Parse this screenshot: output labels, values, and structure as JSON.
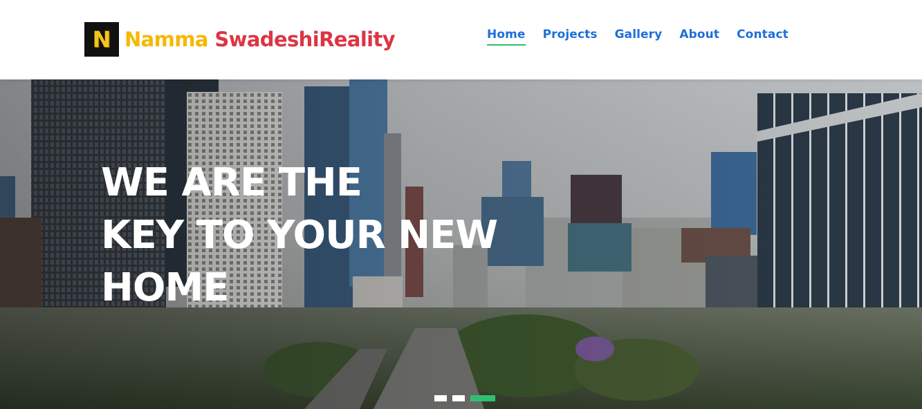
{
  "brand": {
    "logo_letter": "N",
    "name_part1": "Namma ",
    "name_part2": "SwadeshiReality",
    "colors": {
      "part1": "#f5b800",
      "part2": "#dc3545",
      "logo_bg": "#111111",
      "logo_letter": "#f5c518"
    }
  },
  "nav": {
    "items": [
      {
        "label": "Home",
        "active": true
      },
      {
        "label": "Projects",
        "active": false
      },
      {
        "label": "Gallery",
        "active": false
      },
      {
        "label": "About",
        "active": false
      },
      {
        "label": "Contact",
        "active": false
      }
    ],
    "colors": {
      "link": "#1e6fd9",
      "active_underline": "#2fbf71"
    }
  },
  "hero": {
    "headline_lines": [
      "WE ARE THE",
      "KEY TO YOUR NEW",
      "HOME"
    ],
    "background": "city-skyline-photo",
    "carousel": {
      "slides": 3,
      "active_index": 2,
      "active_color": "#2fbf71"
    }
  }
}
